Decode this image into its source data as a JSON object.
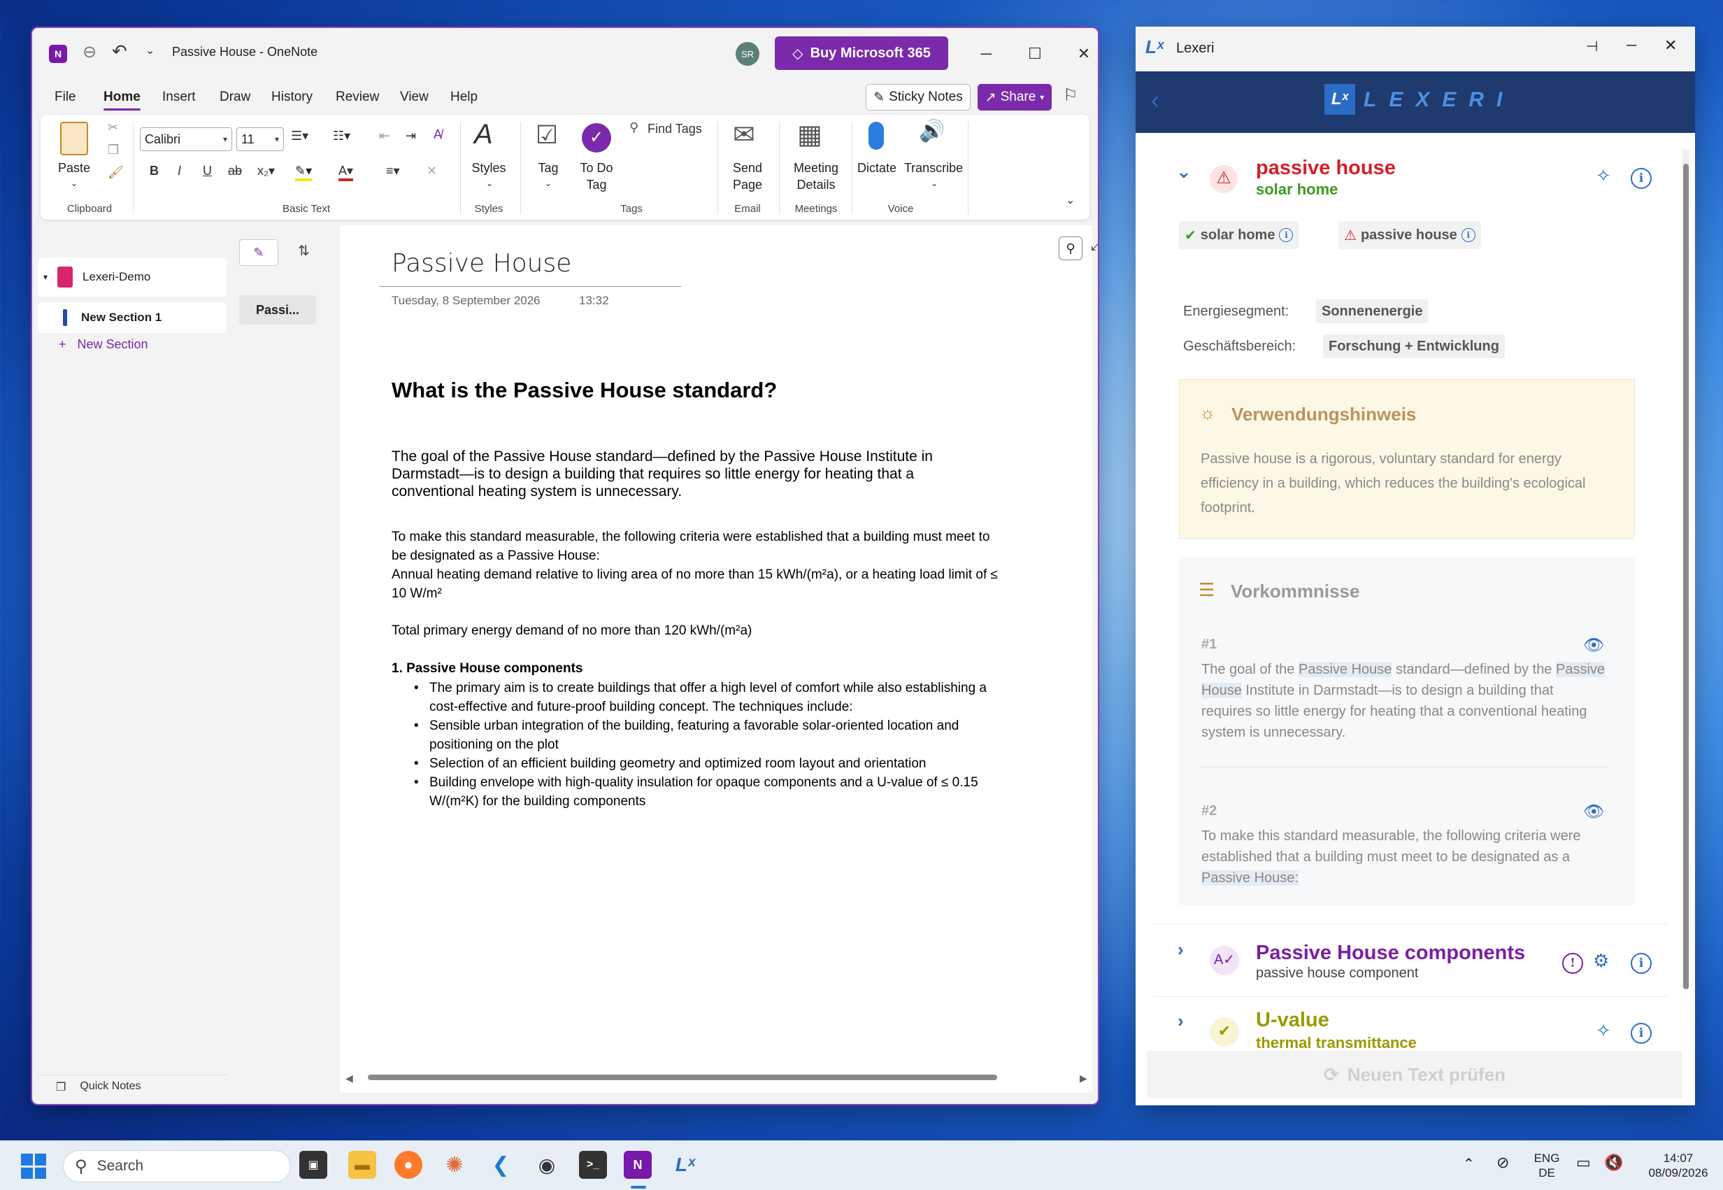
{
  "onenote": {
    "window_title": "Passive House  -  OneNote",
    "avatar": "SR",
    "buy_label": "Buy Microsoft 365",
    "menu": [
      "File",
      "Home",
      "Insert",
      "Draw",
      "History",
      "Review",
      "View",
      "Help"
    ],
    "sticky_notes": "Sticky Notes",
    "share": "Share",
    "ribbon": {
      "paste": "Paste",
      "clipboard": "Clipboard",
      "font": "Calibri",
      "size": "11",
      "basic_text": "Basic Text",
      "styles": "Styles",
      "styles_group": "Styles",
      "tag": "Tag",
      "todo_tag_1": "To Do",
      "todo_tag_2": "Tag",
      "find_tags": "Find Tags",
      "tags_group": "Tags",
      "send_page_1": "Send",
      "send_page_2": "Page",
      "email_group": "Email",
      "meeting_1": "Meeting",
      "meeting_2": "Details",
      "meetings_group": "Meetings",
      "dictate": "Dictate",
      "transcribe": "Transcribe",
      "voice_group": "Voice"
    },
    "nav": {
      "notebook": "Lexeri-Demo",
      "section": "New Section 1",
      "new_section": "New Section",
      "quick_notes": "Quick Notes"
    },
    "page_tab": "Passi...",
    "page": {
      "title": "Passive House",
      "date": "Tuesday, 8 September 2026",
      "time": "13:32",
      "heading": "What is the Passive House standard?",
      "intro": "The goal of the Passive House standard—defined by the Passive House Institute in Darmstadt—is to design a building that requires so little energy for heating that a conventional heating system is unnecessary.",
      "criteria": "To make this standard measurable, the following criteria were established that a building must meet to be designated as a Passive House:",
      "heating": "Annual heating demand relative to living area of no more than 15 kWh/(m²a), or a heating load limit of ≤ 10 W/m²",
      "primary": "Total primary energy demand of no more than 120 kWh/(m²a)",
      "components_heading": "1. Passive House components",
      "bullets": [
        "The primary aim is to create buildings that offer a high level of comfort while also establishing a cost-effective and future-proof building concept. The techniques include:",
        "Sensible urban integration of the building, featuring a favorable solar-oriented location and positioning on the plot",
        "Selection of an efficient building geometry and optimized room layout and orientation",
        "Building envelope with high-quality insulation for opaque components and a U-value of ≤ 0.15 W/(m²K) for the building components"
      ]
    }
  },
  "lexeri": {
    "window_title": "Lexeri",
    "logo_mark": "Lˣ",
    "logo_text": "LEXERI",
    "term1": {
      "title": "passive house",
      "subtitle": "solar home",
      "chip_ok": "solar home",
      "chip_warn": "passive house",
      "energy_label": "Energiesegment:",
      "energy_value": "Sonnenenergie",
      "business_label": "Geschäftsbereich:",
      "business_value": "Forschung + Entwicklung",
      "hint_title": "Verwendungshinweis",
      "hint_text": "Passive house is a rigorous, voluntary standard for energy efficiency in a building, which reduces the building's ecological footprint.",
      "occ_title": "Vorkommnisse",
      "occ1_num": "#1",
      "occ1_a": "The goal of the ",
      "occ1_hl1": "Passive House",
      "occ1_b": " standard—defined by the ",
      "occ1_hl2": "Passive House",
      "occ1_c": " Institute in Darmstadt—is to design a building that requires so little energy for heating that a conventional heating system is unnecessary.",
      "occ2_num": "#2",
      "occ2_a": "To make this standard measurable, the following criteria were established that a building must meet to be designated as a ",
      "occ2_hl": "Passive House:"
    },
    "term2": {
      "title": "Passive House components",
      "subtitle": "passive house component"
    },
    "term3": {
      "title": "U-value",
      "subtitle": "thermal transmittance"
    },
    "footer_button": "Neuen Text prüfen",
    "colors": {
      "warn_red": "#d4202a",
      "ok_green": "#3c9a1e",
      "purple": "#7b1fa2",
      "olive": "#9a9a00",
      "accent_blue": "#2c6ec8"
    }
  },
  "taskbar": {
    "search": "Search",
    "lang_1": "ENG",
    "lang_2": "DE",
    "time": "14:07",
    "date": "08/09/2026"
  }
}
